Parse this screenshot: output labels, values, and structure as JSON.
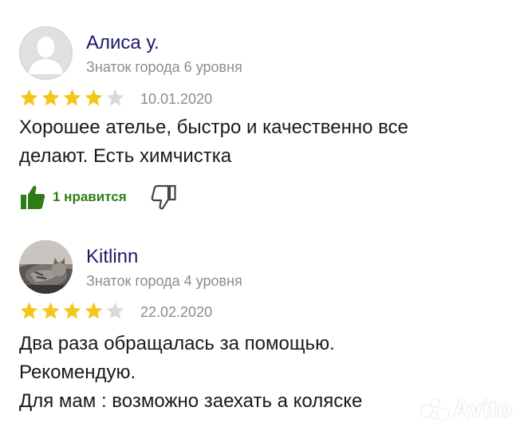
{
  "reviews": [
    {
      "author": "Алиса у.",
      "level": "Знаток города 6 уровня",
      "rating": 4,
      "max_rating": 5,
      "date": "10.01.2020",
      "text_lines": [
        "Хорошее ателье, быстро и качественно все",
        "делают. Есть химчистка"
      ],
      "like_label": "1 нравится",
      "avatar": "default-user-avatar"
    },
    {
      "author": "Kitlinn",
      "level": "Знаток города 4 уровня",
      "rating": 4,
      "max_rating": 5,
      "date": "22.02.2020",
      "text_lines": [
        "Два раза обращалась за помощью.",
        "Рекомендую.",
        "Для мам : возможно заехать а коляске"
      ],
      "avatar": "cat-photo-avatar"
    }
  ],
  "colors": {
    "author": "#1b1b6a",
    "meta": "#8c8c8c",
    "star_filled": "#f5c518",
    "star_empty": "#d9d9d9",
    "like_green": "#2e7d14"
  },
  "watermark": {
    "text": "Avito"
  }
}
